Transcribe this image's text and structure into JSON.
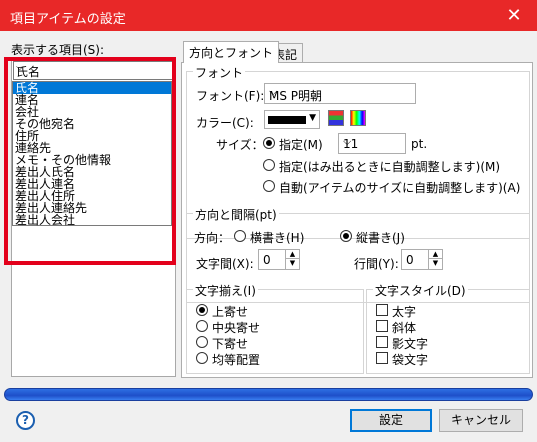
{
  "window": {
    "title": "項目アイテムの設定",
    "close": "✕"
  },
  "items_panel": {
    "label": "表示する項目(S):",
    "selected": "氏名",
    "options": [
      "氏名",
      "連名",
      "会社",
      "その他宛名",
      "住所",
      "連絡先",
      "メモ・その他情報",
      "差出人氏名",
      "差出人連名",
      "差出人住所",
      "差出人連絡先",
      "差出人会社"
    ]
  },
  "tabs": [
    "方向とフォント",
    "表記"
  ],
  "font_group": {
    "title": "フォント",
    "font_label": "フォント(F):",
    "font_value": "MS P明朝",
    "color_label": "カラー(C):",
    "color_value": "#000000",
    "size_label": "サイズ：",
    "radio_fixed": "指定(M)",
    "size_value": "11",
    "size_unit": "pt.",
    "radio_overflow": "指定(はみ出るときに自動調整します)(M)",
    "radio_auto": "自動(アイテムのサイズに自動調整します)(A)"
  },
  "direction_group": {
    "title": "方向と間隔(pt)",
    "direction_label": "方向：",
    "horizontal": "横書き(H)",
    "vertical": "縦書き(J)",
    "char_spacing_label": "文字間(X):",
    "char_spacing": "0",
    "line_spacing_label": "行間(Y):",
    "line_spacing": "0"
  },
  "align_group": {
    "title": "文字揃え(I)",
    "options": [
      "上寄せ",
      "中央寄せ",
      "下寄せ",
      "均等配置"
    ],
    "selected_index": 0
  },
  "style_group": {
    "title": "文字スタイル(D)",
    "options": [
      "太字",
      "斜体",
      "影文字",
      "袋文字"
    ]
  },
  "progress": {
    "value": 1.0,
    "color": "#1e4fc9"
  },
  "buttons": {
    "help": "?",
    "ok": "設定",
    "cancel": "キャンセル"
  },
  "colors": {
    "titlebar": "#e82828",
    "highlight_box": "#e3001b",
    "selection": "#0078d7"
  }
}
